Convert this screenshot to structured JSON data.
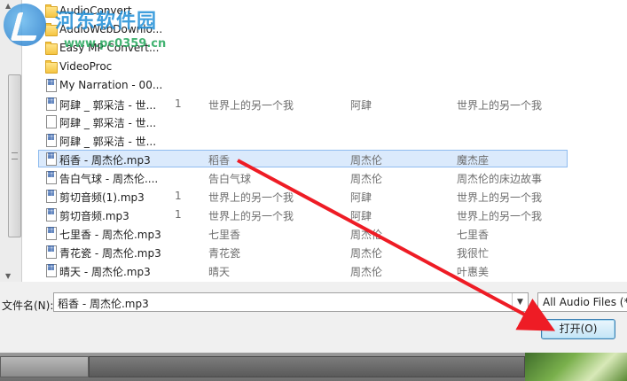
{
  "watermark": {
    "brand": "河东软件园",
    "url": "www.pc0359.cn"
  },
  "file_list": {
    "rows": [
      {
        "type": "folder",
        "name": "AudioConvert",
        "num": "",
        "title": "",
        "artist": "",
        "album": ""
      },
      {
        "type": "folder",
        "name": "AudioWebDownlo...",
        "num": "",
        "title": "",
        "artist": "",
        "album": ""
      },
      {
        "type": "folder",
        "name": "Easy MP Convert...",
        "num": "",
        "title": "",
        "artist": "",
        "album": ""
      },
      {
        "type": "folder",
        "name": "VideoProc",
        "num": "",
        "title": "",
        "artist": "",
        "album": ""
      },
      {
        "type": "audio",
        "name": "My Narration - 00...",
        "num": "",
        "title": "",
        "artist": "",
        "album": ""
      },
      {
        "type": "audio",
        "name": "阿肆 _ 郭采洁 - 世...",
        "num": "1",
        "title": "世界上的另一个我",
        "artist": "阿肆",
        "album": "世界上的另一个我"
      },
      {
        "type": "blank",
        "name": "阿肆 _ 郭采洁 - 世...",
        "num": "",
        "title": "",
        "artist": "",
        "album": ""
      },
      {
        "type": "audio",
        "name": "阿肆 _ 郭采洁 - 世...",
        "num": "",
        "title": "",
        "artist": "",
        "album": ""
      },
      {
        "type": "audio",
        "name": "稻香 - 周杰伦.mp3",
        "num": "",
        "title": "稻香",
        "artist": "周杰伦",
        "album": "魔杰座",
        "selected": true
      },
      {
        "type": "audio",
        "name": "告白气球 - 周杰伦....",
        "num": "",
        "title": "告白气球",
        "artist": "周杰伦",
        "album": "周杰伦的床边故事"
      },
      {
        "type": "audio",
        "name": "剪切音频(1).mp3",
        "num": "1",
        "title": "世界上的另一个我",
        "artist": "阿肆",
        "album": "世界上的另一个我"
      },
      {
        "type": "audio",
        "name": "剪切音频.mp3",
        "num": "1",
        "title": "世界上的另一个我",
        "artist": "阿肆",
        "album": "世界上的另一个我"
      },
      {
        "type": "audio",
        "name": "七里香 - 周杰伦.mp3",
        "num": "",
        "title": "七里香",
        "artist": "周杰伦",
        "album": "七里香"
      },
      {
        "type": "audio",
        "name": "青花瓷 - 周杰伦.mp3",
        "num": "",
        "title": "青花瓷",
        "artist": "周杰伦",
        "album": "我很忙"
      },
      {
        "type": "audio",
        "name": "晴天 - 周杰伦.mp3",
        "num": "",
        "title": "晴天",
        "artist": "周杰伦",
        "album": "叶惠美"
      }
    ]
  },
  "filename": {
    "label": "文件名(N):",
    "value": "稻香 - 周杰伦.mp3"
  },
  "filter": {
    "value": "All Audio Files (*"
  },
  "open_button": {
    "label": "打开(O)"
  },
  "colors": {
    "selection": "#dbeafc",
    "arrow": "#ee1c25",
    "wm_blue": "#1f8fd8",
    "wm_green": "#23a65a"
  }
}
